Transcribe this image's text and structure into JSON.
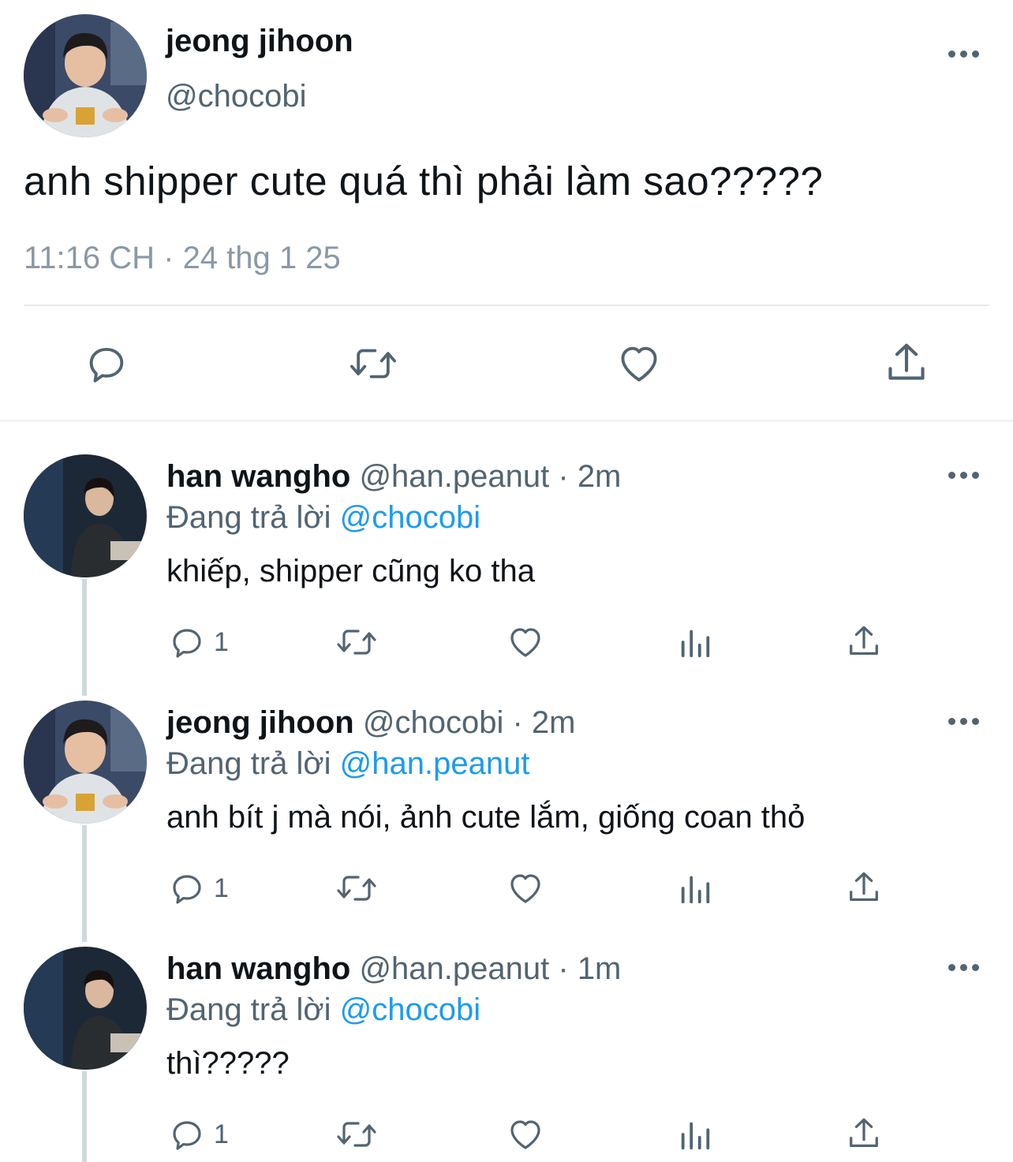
{
  "main_tweet": {
    "author_name": "jeong jihoon",
    "author_handle": "@chocobi",
    "text": "anh shipper cute quá thì phải làm sao?????",
    "timestamp": "11:16 CH · 24 thg 1 25",
    "more_icon": "more-horizontal-icon",
    "actions": [
      "reply-icon",
      "retweet-icon",
      "like-icon",
      "share-icon"
    ]
  },
  "replies": [
    {
      "author_name": "han wangho",
      "author_handle": "@han.peanut",
      "separator": " · ",
      "time": "2m",
      "replying_prefix": "Đang trả lời ",
      "replying_to": "@chocobi",
      "text": "khiếp, shipper cũng ko tha",
      "reply_count": "1"
    },
    {
      "author_name": "jeong jihoon",
      "author_handle": "@chocobi",
      "separator": " · ",
      "time": "2m",
      "replying_prefix": "Đang trả lời ",
      "replying_to": "@han.peanut",
      "text": "anh bít j mà nói, ảnh cute lắm, giống coan thỏ",
      "reply_count": "1"
    },
    {
      "author_name": "han wangho",
      "author_handle": "@han.peanut",
      "separator": " · ",
      "time": "1m",
      "replying_prefix": "Đang trả lời ",
      "replying_to": "@chocobi",
      "text": "thì?????",
      "reply_count": "1"
    }
  ],
  "colors": {
    "text": "#0f1419",
    "secondary": "#536471",
    "mention": "#1d9bf0",
    "divider": "#e7e9ea",
    "thread_line": "#cfd9de"
  }
}
